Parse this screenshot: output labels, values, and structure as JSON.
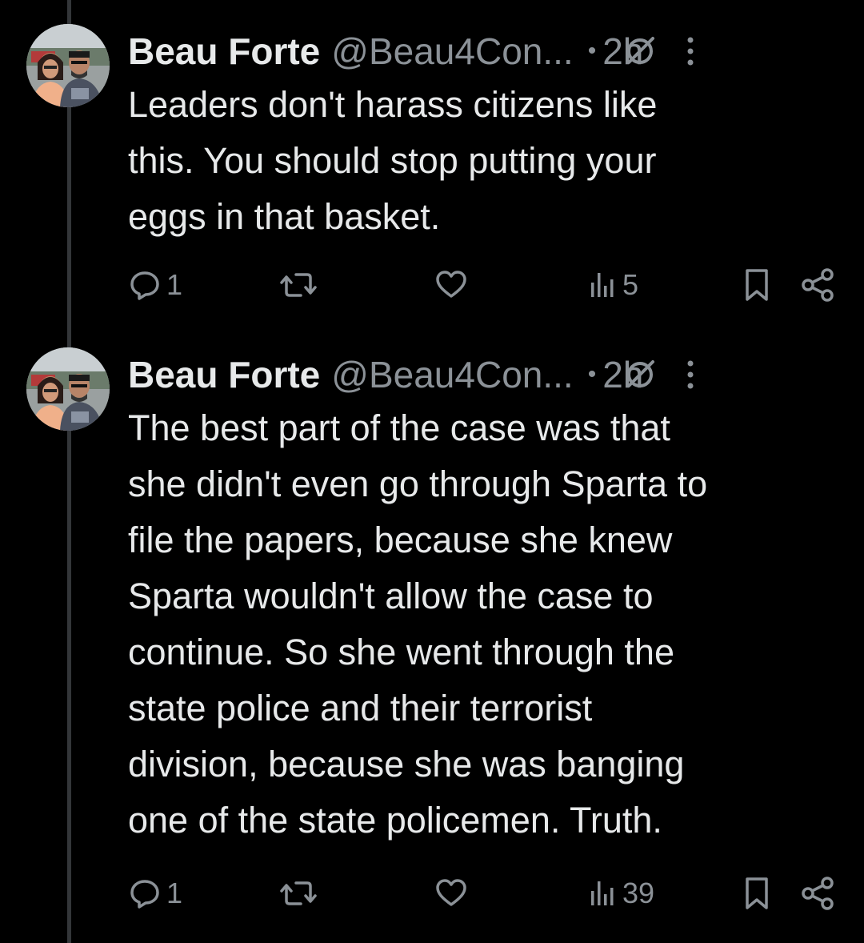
{
  "tweets": [
    {
      "author": {
        "display_name": "Beau Forte",
        "handle": "@Beau4Con...",
        "avatar": "avatar-photo"
      },
      "separator": "•",
      "time": "2h",
      "text": "Leaders don't harass citizens like\nthis.  You should stop putting your\neggs in that basket.",
      "metrics": {
        "replies": "1",
        "reposts": "",
        "likes": "",
        "views": "5"
      },
      "icons": [
        "grok-icon",
        "more-icon",
        "reply-icon",
        "repost-icon",
        "heart-icon",
        "views-icon",
        "bookmark-icon",
        "share-icon"
      ]
    },
    {
      "author": {
        "display_name": "Beau Forte",
        "handle": "@Beau4Con...",
        "avatar": "avatar-photo"
      },
      "separator": "•",
      "time": "2h",
      "text": "The best part of the case was that\nshe didn't even go through Sparta to\nfile the papers, because she knew\nSparta wouldn't allow the case to\ncontinue.  So she went through the\nstate police and their terrorist\ndivision, because she was banging\none of the state policemen.  Truth.",
      "metrics": {
        "replies": "1",
        "reposts": "",
        "likes": "",
        "views": "39"
      },
      "icons": [
        "grok-icon",
        "more-icon",
        "reply-icon",
        "repost-icon",
        "heart-icon",
        "views-icon",
        "bookmark-icon",
        "share-icon"
      ]
    }
  ],
  "colors": {
    "background": "#000000",
    "text_primary": "#e7e9ea",
    "text_secondary": "#8b9197",
    "thread_line": "#333639"
  }
}
